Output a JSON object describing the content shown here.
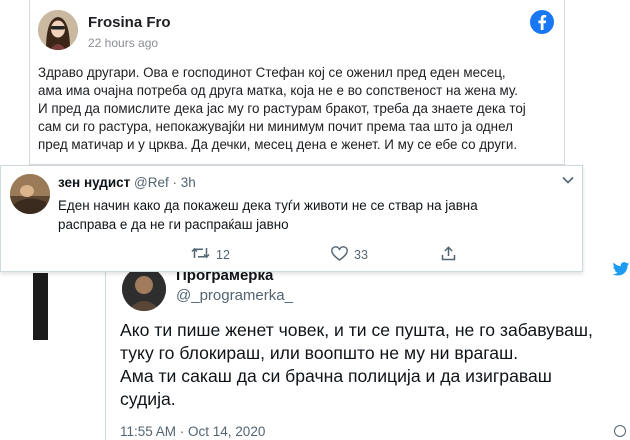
{
  "facebook_post": {
    "author": "Frosina Fro",
    "time": "22 hours ago",
    "icon": "facebook-logo-icon",
    "lines": [
      "Здраво другари. Ова е господинот Стефан кој се оженил пред еден месец,",
      "ама има очајна потреба од друга матка, која не е во сопственост на жена му.",
      "И пред да помислите дека јас му го растурам бракот, треба да знаете дека тој",
      "сам си го растура, непокажувајќи ни минимум почит према таа што ја однел",
      "пред матичар и у црква. Да дечки, месец дена е женет. И му се ебе со други."
    ]
  },
  "reply_tweet": {
    "name": "зен нудист",
    "handle": "@Ref",
    "separator": "·",
    "time": "3h",
    "lines": [
      "Еден начин како да покажеш дека туѓи животи не се ствар на јавна",
      "расправа е да не ги распраќаш јавно"
    ],
    "retweets": "12",
    "likes": "33"
  },
  "background_tweet": {
    "name": "Програмерка",
    "handle": "@_programerka_",
    "lines": [
      "Ако ти пише женет човек, и ти се пушта, не го забавуваш,",
      "туку го блокираш, или воопшто не му ни врагаш.",
      "Ама ти сакаш да си брачна полиција и да изиграваш",
      "судија."
    ],
    "timestamp": "11:55 AM · Oct 14, 2020"
  },
  "colors": {
    "facebook_blue": "#1877f2",
    "twitter_blue": "#1d9bf0",
    "text": "#0f1419",
    "muted": "#536471"
  }
}
